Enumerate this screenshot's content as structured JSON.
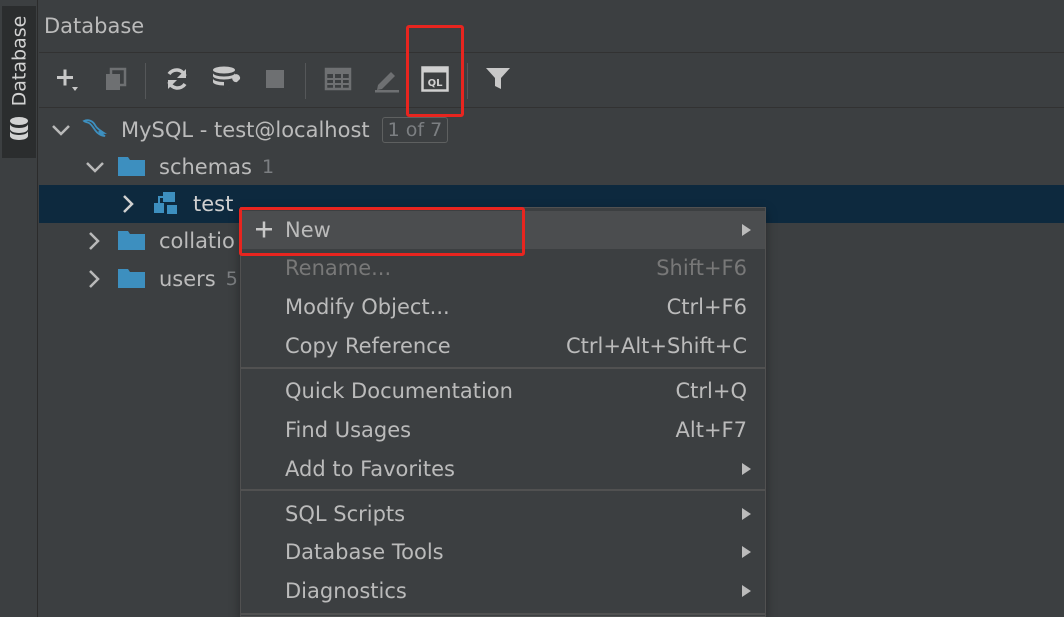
{
  "panel": {
    "title": "Database",
    "side_tab_label": "Database"
  },
  "toolbar": {
    "buttons": [
      {
        "name": "add",
        "icon": "plus-icon"
      },
      {
        "name": "duplicate",
        "icon": "copy-icon"
      },
      {
        "name": "refresh",
        "icon": "refresh-icon"
      },
      {
        "name": "data-source-properties",
        "icon": "database-wrench-icon"
      },
      {
        "name": "stop",
        "icon": "stop-icon"
      },
      {
        "name": "table-editor",
        "icon": "table-icon"
      },
      {
        "name": "edit-source",
        "icon": "pencil-icon"
      },
      {
        "name": "jump-to-console",
        "icon": "ql-console-icon"
      },
      {
        "name": "filter",
        "icon": "funnel-icon"
      }
    ],
    "ql_icon_text": "QL"
  },
  "tree": {
    "datasource": {
      "label": "MySQL - test@localhost",
      "badge": "1 of 7",
      "icon": "mysql-dolphin-icon"
    },
    "schemas": {
      "label": "schemas",
      "count": "1"
    },
    "schema_test": {
      "label": "test"
    },
    "collations": {
      "label": "collatio"
    },
    "users": {
      "label": "users",
      "count": "5"
    }
  },
  "context_menu": {
    "items": [
      {
        "label": "New",
        "shortcut": "",
        "submenu": true,
        "enabled": true,
        "icon": "plus-icon"
      },
      {
        "label": "Rename...",
        "shortcut": "Shift+F6",
        "submenu": false,
        "enabled": false
      },
      {
        "label": "Modify Object...",
        "shortcut": "Ctrl+F6",
        "submenu": false,
        "enabled": true
      },
      {
        "label": "Copy Reference",
        "shortcut": "Ctrl+Alt+Shift+C",
        "submenu": false,
        "enabled": true
      },
      {
        "label": "Quick Documentation",
        "shortcut": "Ctrl+Q",
        "submenu": false,
        "enabled": true
      },
      {
        "label": "Find Usages",
        "shortcut": "Alt+F7",
        "submenu": false,
        "enabled": true
      },
      {
        "label": "Add to Favorites",
        "shortcut": "",
        "submenu": true,
        "enabled": true
      },
      {
        "label": "SQL Scripts",
        "shortcut": "",
        "submenu": true,
        "enabled": true
      },
      {
        "label": "Database Tools",
        "shortcut": "",
        "submenu": true,
        "enabled": true
      },
      {
        "label": "Diagnostics",
        "shortcut": "",
        "submenu": true,
        "enabled": true
      }
    ]
  },
  "colors": {
    "background": "#3c3f41",
    "selection": "#0d293e",
    "highlight_box": "#e8251f",
    "folder": "#3d8fbf",
    "text": "#bbbbbb",
    "disabled_text": "#787878"
  }
}
